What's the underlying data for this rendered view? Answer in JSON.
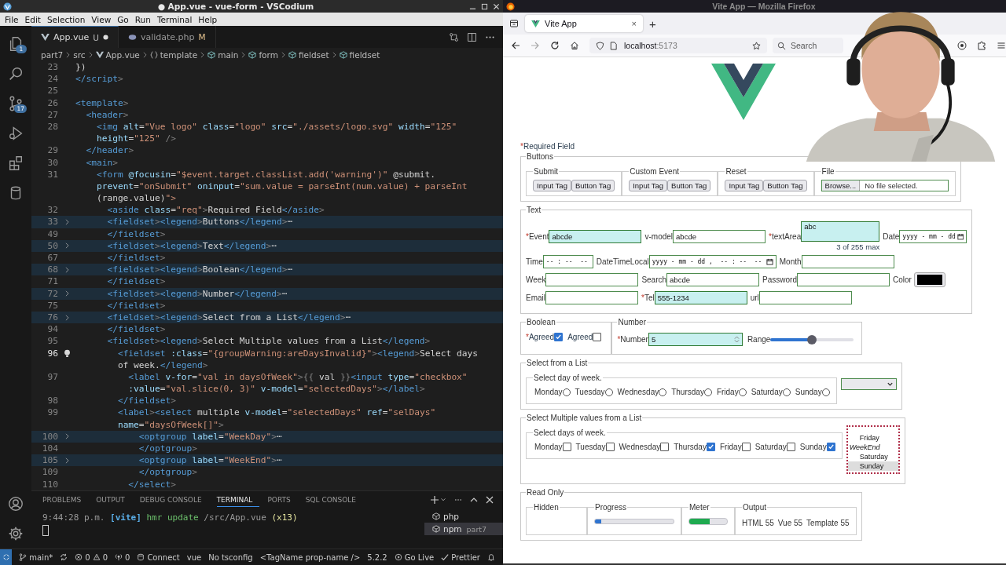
{
  "editor_window": {
    "title": "● App.vue - vue-form - VSCodium",
    "menu": [
      "File",
      "Edit",
      "Selection",
      "View",
      "Go",
      "Run",
      "Terminal",
      "Help"
    ],
    "activity_bar": [
      {
        "kind": "explorer",
        "badge": "1"
      },
      {
        "kind": "search"
      },
      {
        "kind": "source-control",
        "badge": "17"
      },
      {
        "kind": "run"
      },
      {
        "kind": "extensions"
      },
      {
        "kind": "database"
      }
    ],
    "tabs": [
      {
        "label": "App.vue",
        "status": "U",
        "kind": "vue",
        "modified": true,
        "selected": true
      },
      {
        "label": "validate.php",
        "status": "M",
        "kind": "php",
        "modified": false,
        "selected": false
      }
    ],
    "breadcrumbs": [
      {
        "label": "part7",
        "kind": "folder"
      },
      {
        "label": "src",
        "kind": "folder"
      },
      {
        "label": "App.vue",
        "kind": "vue"
      },
      {
        "label": "template",
        "kind": "braces"
      },
      {
        "label": "main",
        "kind": "element"
      },
      {
        "label": "form",
        "kind": "element"
      },
      {
        "label": "fieldset",
        "kind": "element"
      },
      {
        "label": "fieldset",
        "kind": "element"
      }
    ],
    "code_lines": [
      {
        "number": "23",
        "text": "})",
        "folded": false,
        "current": false
      },
      {
        "number": "24",
        "text": "</script>",
        "folded": false,
        "current": false
      },
      {
        "number": "25",
        "folded": false,
        "current": false
      },
      {
        "number": "26",
        "text": "<template>",
        "folded": false,
        "current": false
      },
      {
        "number": "27",
        "text": "  <header>",
        "folded": false,
        "current": false
      },
      {
        "number": "28",
        "text": "    <img alt=\"Vue logo\" class=\"logo\" src=\"./assets/logo.svg\" width=\"125\"",
        "wrap": [
          "    height=\"125\" />"
        ],
        "folded": false,
        "current": false
      },
      {
        "number": "29",
        "text": "  </header>",
        "folded": false,
        "current": false
      },
      {
        "number": "30",
        "text": "  <main>",
        "folded": false,
        "current": false
      },
      {
        "number": "31",
        "text": "    <form @focusin=\"$event.target.classList.add('warning')\" @submit.",
        "wrap": [
          "    prevent=\"onSubmit\" oninput=\"sum.value = parseInt(num.value) + parseInt",
          "    (range.value)\">"
        ],
        "folded": false,
        "current": false
      },
      {
        "number": "32",
        "text": "      <aside class=\"req\">Required Field</aside>",
        "folded": false,
        "current": false
      },
      {
        "number": "33",
        "text": "      <fieldset><legend>Buttons</legend>⋯",
        "folded": true,
        "current": false
      },
      {
        "number": "49",
        "text": "      </fieldset>",
        "folded": false,
        "current": false
      },
      {
        "number": "50",
        "text": "      <fieldset><legend>Text</legend>⋯",
        "folded": true,
        "current": false
      },
      {
        "number": "67",
        "text": "      </fieldset>",
        "folded": false,
        "current": false
      },
      {
        "number": "68",
        "text": "      <fieldset><legend>Boolean</legend>⋯",
        "folded": true,
        "current": false
      },
      {
        "number": "71",
        "text": "      </fieldset>",
        "folded": false,
        "current": false
      },
      {
        "number": "72",
        "text": "      <fieldset><legend>Number</legend>⋯",
        "folded": true,
        "current": false
      },
      {
        "number": "75",
        "text": "      </fieldset>",
        "folded": false,
        "current": false
      },
      {
        "number": "76",
        "text": "      <fieldset><legend>Select from a List</legend>⋯",
        "folded": true,
        "current": false
      },
      {
        "number": "94",
        "text": "      </fieldset>",
        "folded": false,
        "current": false
      },
      {
        "number": "95",
        "text": "      <fieldset><legend>Select Multiple values from a List</legend>",
        "folded": false,
        "current": false
      },
      {
        "number": "96",
        "text": "        <fieldset :class=\"{groupWarning:areDaysInvalid}\"><legend>Select days",
        "wrap": [
          "        of week.</legend>"
        ],
        "folded": false,
        "current": true
      },
      {
        "number": "97",
        "text": "          <label v-for=\"val in daysOfWeek\">{{ val }}<input type=\"checkbox\"",
        "wrap": [
          "          :value=\"val.slice(0, 3)\" v-model=\"selectedDays\"></label>"
        ],
        "folded": false,
        "current": false
      },
      {
        "number": "98",
        "text": "        </fieldset>",
        "folded": false,
        "current": false
      },
      {
        "number": "99",
        "text": "        <label><select multiple v-model=\"selectedDays\" ref=\"selDays\"",
        "wrap": [
          "        name=\"daysOfWeek[]\">"
        ],
        "folded": false,
        "current": false
      },
      {
        "number": "100",
        "text": "            <optgroup label=\"WeekDay\">⋯",
        "folded": true,
        "current": false
      },
      {
        "number": "104",
        "text": "            </optgroup>",
        "folded": false,
        "current": false
      },
      {
        "number": "105",
        "text": "            <optgroup label=\"WeekEnd\">⋯",
        "folded": true,
        "current": false
      },
      {
        "number": "109",
        "text": "            </optgroup>",
        "folded": false,
        "current": false
      },
      {
        "number": "110",
        "text": "          </select>",
        "folded": false,
        "current": false
      }
    ],
    "panel": {
      "tabs": [
        {
          "label": "PROBLEMS",
          "selected": false
        },
        {
          "label": "OUTPUT",
          "selected": false
        },
        {
          "label": "DEBUG CONSOLE",
          "selected": false
        },
        {
          "label": "TERMINAL",
          "selected": true
        },
        {
          "label": "PORTS",
          "selected": false
        },
        {
          "label": "SQL CONSOLE",
          "selected": false
        }
      ],
      "terminal_line": [
        {
          "text": "9:44:28 p.m.",
          "kind": "time"
        },
        {
          "text": "[vite]",
          "kind": "tag"
        },
        {
          "text": "hmr update",
          "kind": "action"
        },
        {
          "text": "/src/App.vue",
          "kind": "path"
        },
        {
          "text": "(x13)",
          "kind": "count"
        }
      ],
      "terminals": [
        {
          "label": "php",
          "selected": false
        },
        {
          "label": "npm",
          "detail": "part7",
          "selected": true
        }
      ]
    },
    "status_bar": [
      {
        "kind": "remote"
      },
      {
        "kind": "branch",
        "text": "main*"
      },
      {
        "kind": "sync"
      },
      {
        "kind": "problems",
        "errors": "0",
        "warnings": "0"
      },
      {
        "kind": "ports",
        "text": "0"
      },
      {
        "kind": "db",
        "text": "Connect"
      },
      {
        "kind": "plain",
        "text": "vue"
      },
      {
        "kind": "plain",
        "text": "No tsconfig"
      },
      {
        "kind": "plain",
        "text": "<TagName prop-name />"
      },
      {
        "kind": "plain",
        "text": "5.2.2"
      },
      {
        "kind": "golive",
        "text": "Go Live"
      },
      {
        "kind": "prettier",
        "text": "Prettier"
      },
      {
        "kind": "bell"
      }
    ]
  },
  "browser_window": {
    "title": "Vite App — Mozilla Firefox",
    "tab": {
      "label": "Vite App",
      "close": "×"
    },
    "new_tab": "+",
    "url": {
      "host": "localhost",
      "port": ":5173"
    },
    "search": {
      "placeholder": "Search"
    },
    "page": {
      "required_note": {
        "mark": "*",
        "text": "Required Field"
      },
      "buttons": {
        "legend": "Buttons",
        "groups": [
          {
            "legend": "Submit",
            "buttons": [
              "Input Tag",
              "Button Tag"
            ]
          },
          {
            "legend": "Custom Event",
            "buttons": [
              "Input Tag",
              "Button Tag"
            ]
          },
          {
            "legend": "Reset",
            "buttons": [
              "Input Tag",
              "Button Tag"
            ]
          }
        ],
        "file": {
          "legend": "File",
          "button": "Browse...",
          "status": "No file selected."
        }
      },
      "text": {
        "legend": "Text",
        "rows": [
          [
            {
              "label": "Event",
              "mark": "*",
              "kind": "text",
              "value": "abcde",
              "warning": true
            },
            {
              "label": "v-model",
              "kind": "text",
              "value": "abcde",
              "warning": false
            },
            {
              "label": "textArea",
              "mark": "*",
              "kind": "textarea",
              "value": "abc",
              "counter": "3 of 255 max",
              "warning": true
            },
            {
              "label": "Date",
              "kind": "date",
              "placeholder": "yyyy - mm - dd",
              "warning": false
            }
          ],
          [
            {
              "label": "Time",
              "kind": "time",
              "placeholder": "-- : --  --",
              "warning": false
            },
            {
              "label": "DateTimeLocal",
              "kind": "datetime",
              "placeholder": "yyyy - mm - dd ,  -- : --  --",
              "warning": false
            },
            {
              "label": "Month",
              "kind": "text",
              "warning": false
            }
          ],
          [
            {
              "label": "Week",
              "kind": "text",
              "warning": false
            },
            {
              "label": "Search",
              "kind": "text",
              "value": "abcde",
              "warning": false
            },
            {
              "label": "Password",
              "kind": "text",
              "warning": false
            },
            {
              "label": "Color",
              "kind": "color",
              "color": "#000000"
            }
          ],
          [
            {
              "label": "Email",
              "kind": "text",
              "warning": false
            },
            {
              "label": "Tel",
              "mark": "*",
              "kind": "text",
              "value": "555-1234",
              "warning": true
            },
            {
              "label": "url",
              "kind": "text",
              "warning": false
            }
          ]
        ]
      },
      "boolean": {
        "legend": "Boolean",
        "checkboxes": [
          {
            "mark": "*",
            "label": "Agreed",
            "checked": true
          },
          {
            "label": "Agreed",
            "checked": false
          }
        ]
      },
      "number": {
        "legend": "Number",
        "field": {
          "mark": "*",
          "label": "Number",
          "value": "5",
          "warning": true
        },
        "range": {
          "label": "Range",
          "level": 0.5
        }
      },
      "select_one": {
        "legend": "Select from a List",
        "group": "Select day of week.",
        "options": [
          {
            "label": "Monday",
            "selected": false
          },
          {
            "label": "Tuesday",
            "selected": false
          },
          {
            "label": "Wednesday",
            "selected": false
          },
          {
            "label": "Thursday",
            "selected": false
          },
          {
            "label": "Friday",
            "selected": false
          },
          {
            "label": "Saturday",
            "selected": false
          },
          {
            "label": "Sunday",
            "selected": false
          }
        ]
      },
      "select_many": {
        "legend": "Select Multiple values from a List",
        "group": "Select days of week.",
        "options": [
          {
            "label": "Monday",
            "checked": false
          },
          {
            "label": "Tuesday",
            "checked": false
          },
          {
            "label": "Wednesday",
            "checked": false
          },
          {
            "label": "Thursday",
            "checked": true
          },
          {
            "label": "Friday",
            "checked": false
          },
          {
            "label": "Saturday",
            "checked": false
          },
          {
            "label": "Sunday",
            "checked": true
          }
        ],
        "listbox": {
          "warning": true,
          "items": [
            {
              "label": "Friday",
              "kind": "option",
              "selected": false
            },
            {
              "label": "WeekEnd",
              "kind": "group"
            },
            {
              "label": "Saturday",
              "kind": "option",
              "selected": false
            },
            {
              "label": "Sunday",
              "kind": "option",
              "selected": true
            }
          ]
        }
      },
      "read_only": {
        "legend": "Read Only",
        "hidden": {
          "legend": "Hidden"
        },
        "progress": {
          "legend": "Progress",
          "level": 0.08
        },
        "meter": {
          "legend": "Meter",
          "level": 0.55
        },
        "output": {
          "legend": "Output",
          "values": [
            "HTML 55",
            "Vue 55",
            "Template 55"
          ]
        }
      }
    }
  }
}
